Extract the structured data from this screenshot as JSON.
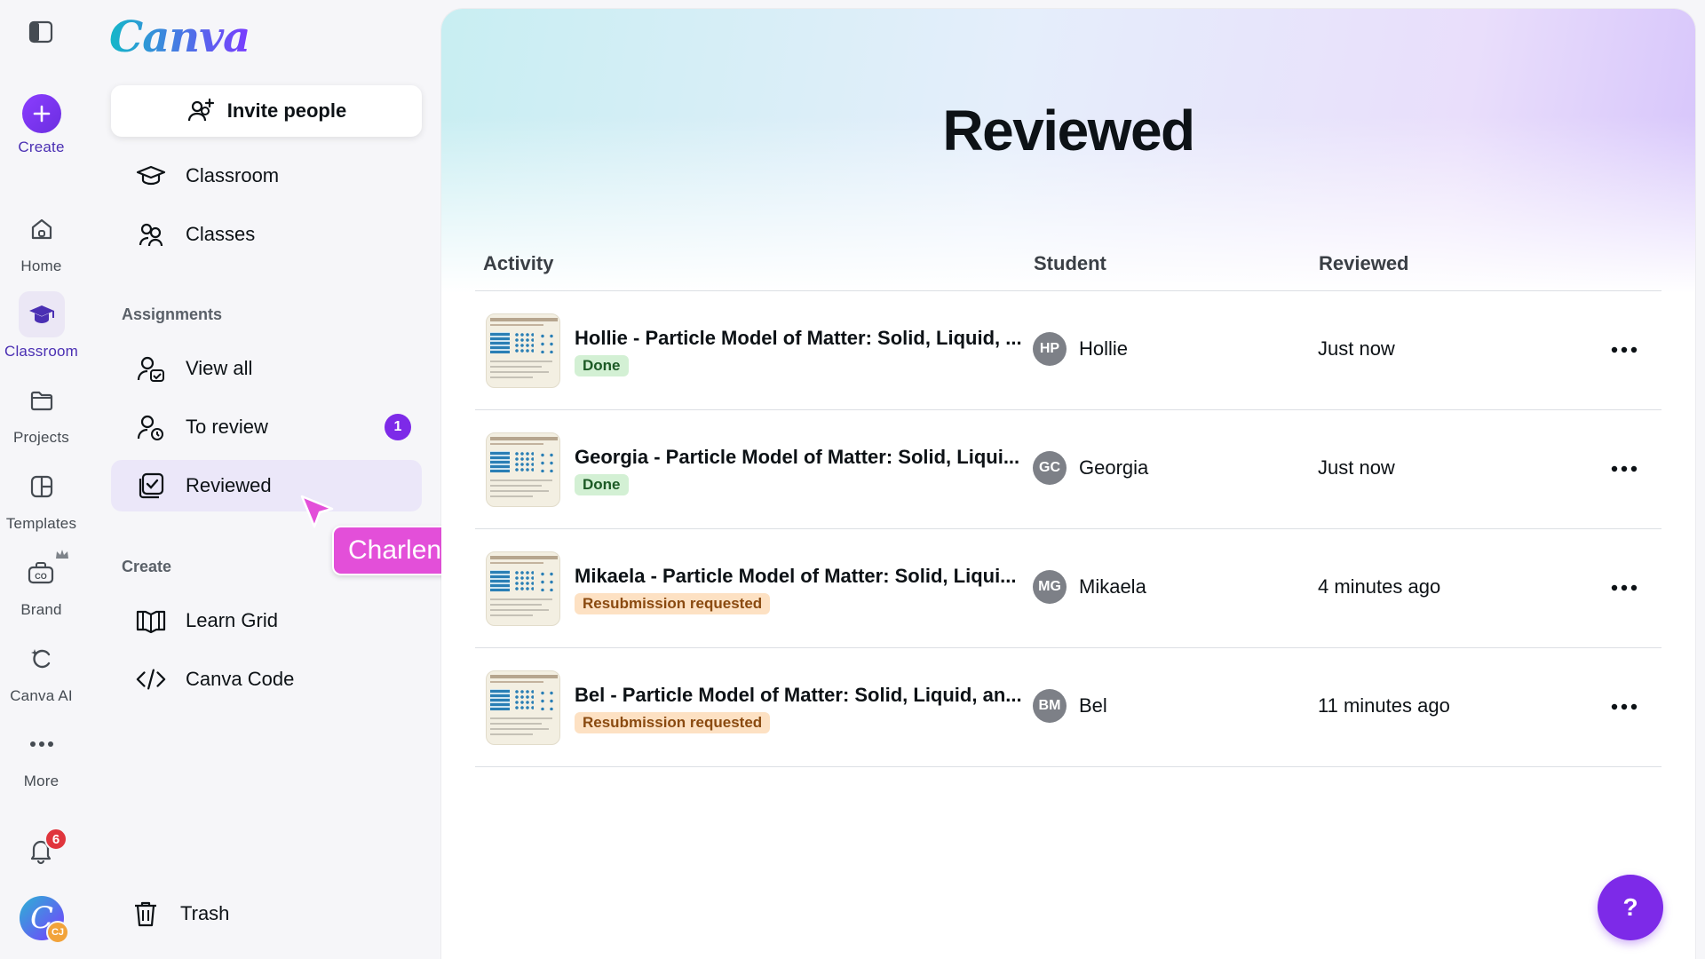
{
  "rail": {
    "create_label": "Create",
    "items": [
      {
        "label": "Home",
        "icon": "home-icon"
      },
      {
        "label": "Classroom",
        "icon": "classroom-icon"
      },
      {
        "label": "Projects",
        "icon": "folder-icon"
      },
      {
        "label": "Templates",
        "icon": "templates-icon"
      },
      {
        "label": "Brand",
        "icon": "brand-icon"
      },
      {
        "label": "Canva AI",
        "icon": "canva-ai-icon"
      },
      {
        "label": "More",
        "icon": "more-icon"
      }
    ],
    "notifications_count": "6",
    "avatar_initials": "CJ",
    "avatar_letter": "C"
  },
  "sidebar": {
    "logo": "Canva",
    "invite_label": "Invite people",
    "classroom_label": "Classroom",
    "classes_label": "Classes",
    "assignments_heading": "Assignments",
    "view_all_label": "View all",
    "to_review_label": "To review",
    "to_review_count": "1",
    "reviewed_label": "Reviewed",
    "create_heading": "Create",
    "learn_grid_label": "Learn Grid",
    "canva_code_label": "Canva Code",
    "trash_label": "Trash"
  },
  "collaborator": {
    "name": "Charlene",
    "color": "#e34fd9"
  },
  "main": {
    "title": "Reviewed",
    "columns": {
      "activity": "Activity",
      "student": "Student",
      "reviewed": "Reviewed"
    },
    "rows": [
      {
        "activity": "Hollie - Particle Model of Matter: Solid, Liquid, ...",
        "status": "Done",
        "initials": "HP",
        "student": "Hollie",
        "reviewed": "Just now"
      },
      {
        "activity": "Georgia - Particle Model of Matter: Solid, Liqui...",
        "status": "Done",
        "initials": "GC",
        "student": "Georgia",
        "reviewed": "Just now"
      },
      {
        "activity": "Mikaela - Particle Model of Matter: Solid, Liqui...",
        "status": "Resubmission requested",
        "initials": "MG",
        "student": "Mikaela",
        "reviewed": "4 minutes ago"
      },
      {
        "activity": "Bel - Particle Model of Matter: Solid, Liquid, an...",
        "status": "Resubmission requested",
        "initials": "BM",
        "student": "Bel",
        "reviewed": "11 minutes ago"
      }
    ],
    "help_label": "?"
  },
  "colors": {
    "accent": "#7d2ae8",
    "done_bg": "#d3f0d4",
    "resubmission_bg": "#fde1c3"
  }
}
